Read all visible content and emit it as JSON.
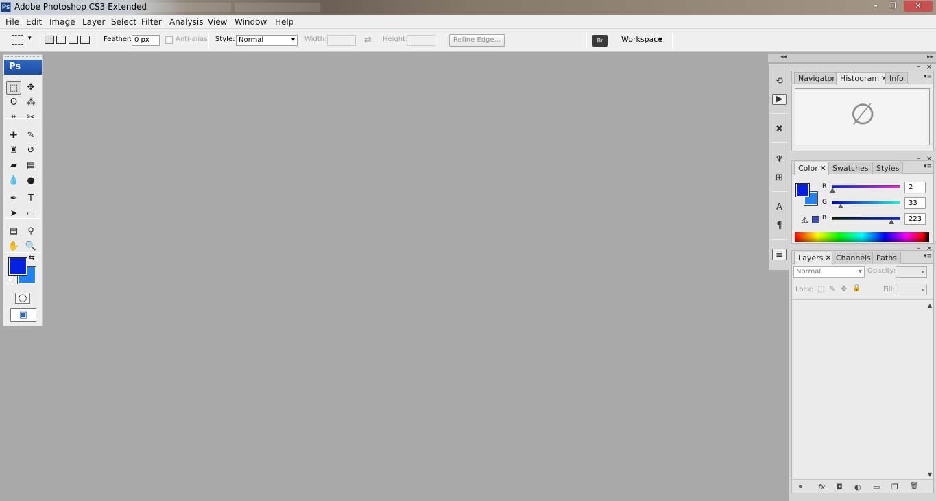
{
  "app": {
    "icon_label": "Ps",
    "title": "Adobe Photoshop CS3 Extended",
    "window_controls": [
      "–",
      "❐",
      "✕"
    ]
  },
  "menu": [
    "File",
    "Edit",
    "Image",
    "Layer",
    "Select",
    "Filter",
    "Analysis",
    "View",
    "Window",
    "Help"
  ],
  "options_bar": {
    "feather_label": "Feather:",
    "feather_value": "0 px",
    "antialias_label": "Anti-alias",
    "style_label": "Style:",
    "style_value": "Normal",
    "width_label": "Width:",
    "height_label": "Height:",
    "refine_edge_label": "Refine Edge...",
    "workspace_label": "Workspace",
    "swap_glyph": "⇄",
    "dropdown_glyph": "▾",
    "bridge_label": "Br"
  },
  "toolbox": {
    "badge": "Ps",
    "tools": [
      {
        "name": "marquee-tool",
        "glyph": "⬚"
      },
      {
        "name": "move-tool",
        "glyph": "✥"
      },
      {
        "name": "lasso-tool",
        "glyph": "ʘ"
      },
      {
        "name": "magic-wand-tool",
        "glyph": "⁂"
      },
      {
        "name": "crop-tool",
        "glyph": "⌗"
      },
      {
        "name": "slice-tool",
        "glyph": "✂"
      },
      {
        "name": "healing-brush-tool",
        "glyph": "✚"
      },
      {
        "name": "brush-tool",
        "glyph": "✎"
      },
      {
        "name": "clone-stamp-tool",
        "glyph": "♜"
      },
      {
        "name": "history-brush-tool",
        "glyph": "↺"
      },
      {
        "name": "eraser-tool",
        "glyph": "▰"
      },
      {
        "name": "gradient-tool",
        "glyph": "▤"
      },
      {
        "name": "blur-tool",
        "glyph": "💧"
      },
      {
        "name": "dodge-tool",
        "glyph": "●"
      },
      {
        "name": "pen-tool",
        "glyph": "✒"
      },
      {
        "name": "type-tool",
        "glyph": "T"
      },
      {
        "name": "path-selection-tool",
        "glyph": "➤"
      },
      {
        "name": "shape-tool",
        "glyph": "▭"
      },
      {
        "name": "notes-tool",
        "glyph": "▤"
      },
      {
        "name": "eyedropper-tool",
        "glyph": "⚲"
      },
      {
        "name": "hand-tool",
        "glyph": "✋"
      },
      {
        "name": "zoom-tool",
        "glyph": "🔍"
      }
    ],
    "swap_glyph": "⇆",
    "quickmask_glyph": "◯",
    "screenmode_glyph": "▣"
  },
  "panels": {
    "nav_group": {
      "tabs": [
        "Navigator",
        "Histogram",
        "Info"
      ],
      "active": "Histogram",
      "empty_glyph": "∅"
    },
    "color_group": {
      "tabs": [
        "Color",
        "Swatches",
        "Styles"
      ],
      "active": "Color",
      "channels": [
        {
          "label": "R",
          "value": "2",
          "level": 2
        },
        {
          "label": "G",
          "value": "33",
          "level": 33
        },
        {
          "label": "B",
          "value": "223",
          "level": 223
        }
      ],
      "gamut_warning_glyph": "⚠"
    },
    "layers_group": {
      "tabs": [
        "Layers",
        "Channels",
        "Paths"
      ],
      "active": "Layers",
      "blend_mode": "Normal",
      "opacity_label": "Opacity:",
      "lock_label": "Lock:",
      "fill_label": "Fill:",
      "lock_glyphs": [
        "⬚",
        "✎",
        "✥",
        "🔒"
      ],
      "bottom_glyphs": [
        "⚭",
        "fx",
        "◘",
        "◐",
        "▭",
        "❐",
        "🗑"
      ]
    }
  },
  "colors": {
    "foreground": "#0421df",
    "background": "#2183f3",
    "workspace": "#a9a9a9"
  }
}
